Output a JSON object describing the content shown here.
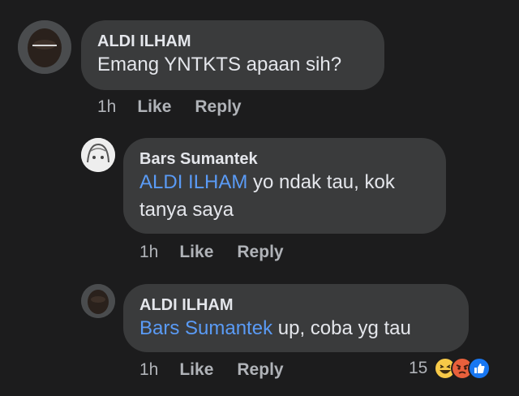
{
  "comments": [
    {
      "author": "ALDI ILHAM",
      "mention": "",
      "text": "Emang YNTKTS apaan sih?",
      "time": "1h",
      "like": "Like",
      "reply": "Reply"
    },
    {
      "author": "Bars Sumantek",
      "mention": "ALDI ILHAM",
      "text_line1": " yo ndak tau, kok",
      "text_line2": "tanya saya",
      "time": "1h",
      "like": "Like",
      "reply": "Reply"
    },
    {
      "author": "ALDI ILHAM",
      "mention": "Bars Sumantek",
      "text": " up, coba yg tau",
      "time": "1h",
      "like": "Like",
      "reply": "Reply",
      "reaction_count": "15",
      "reaction_icons": [
        "haha-icon",
        "angry-icon",
        "like-icon"
      ]
    }
  ],
  "colors": {
    "background": "#1c1c1d",
    "bubble": "#3a3b3c",
    "text": "#e4e6eb",
    "meta": "#b0b3b8",
    "mention": "#5a9bf6"
  }
}
